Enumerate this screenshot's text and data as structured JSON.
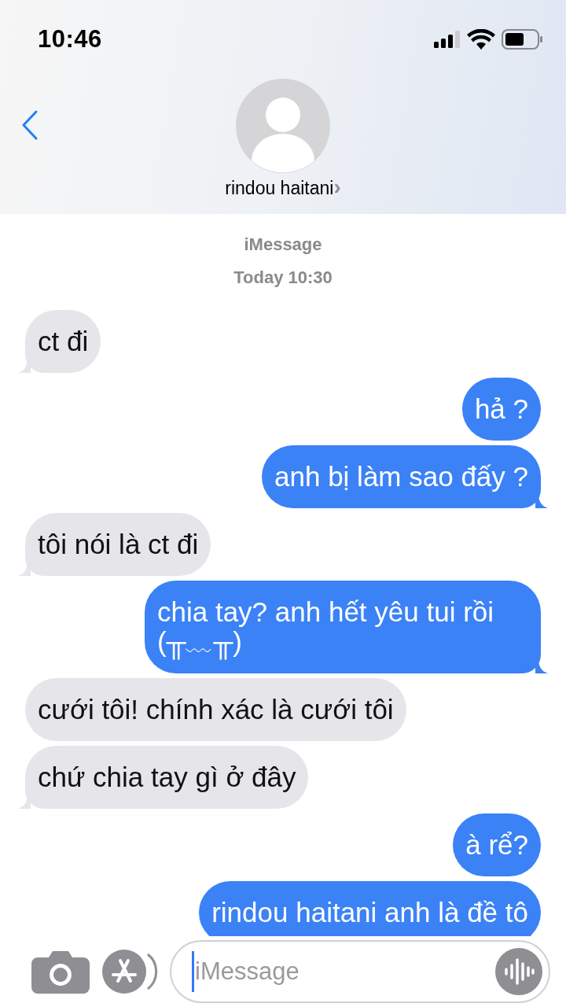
{
  "status_bar": {
    "time": "10:46"
  },
  "header": {
    "contact_name": "rindou haitani",
    "chevron": "›"
  },
  "thread": {
    "service": "iMessage",
    "timestamp": "Today 10:30"
  },
  "messages": [
    {
      "kind": "incoming",
      "text": "ct đi",
      "tail": true
    },
    {
      "kind": "outgoing",
      "text": "hả ?",
      "tail": false
    },
    {
      "kind": "outgoing",
      "text": "anh bị làm sao đấy ?",
      "tail": true
    },
    {
      "kind": "incoming",
      "text": "tôi nói là ct đi",
      "tail": true
    },
    {
      "kind": "outgoing",
      "text": "chia tay? anh hết yêu tui rồi (╥﹏╥)",
      "tail": true
    },
    {
      "kind": "incoming",
      "text": "cưới tôi! chính xác là cưới tôi",
      "tail": false
    },
    {
      "kind": "incoming",
      "text": "chứ chia tay gì ở đây",
      "tail": true
    },
    {
      "kind": "outgoing",
      "text": "à rể?",
      "tail": false
    },
    {
      "kind": "outgoing",
      "text": "rindou haitani anh là đề tô"
    }
  ],
  "composer": {
    "placeholder": "iMessage"
  }
}
